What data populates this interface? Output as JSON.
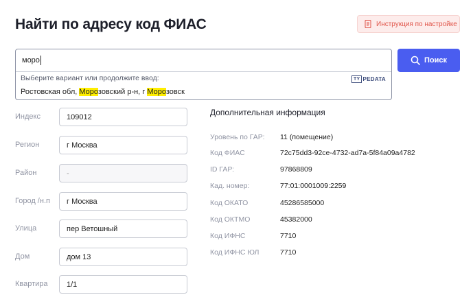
{
  "header": {
    "title": "Найти по адресу код ФИАС",
    "instruction_label": "Инструкция по настройке"
  },
  "search": {
    "value": "моро",
    "hint": "Выберите вариант или продолжите ввод:",
    "logo_box": "TY",
    "logo_rest": "PEDATA",
    "suggestion": {
      "part1": "Ростовская обл, ",
      "hl1": "Моро",
      "part2": "зовский р-н, г ",
      "hl2": "Моро",
      "part3": "зовск"
    },
    "button_label": "Поиск"
  },
  "fields": [
    {
      "label": "Индекс",
      "value": "109012"
    },
    {
      "label": "Регион",
      "value": "г Москва"
    },
    {
      "label": "Район",
      "value": "-"
    },
    {
      "label": "Город /н.п",
      "value": "г Москва"
    },
    {
      "label": "Улица",
      "value": "пер Ветошный"
    },
    {
      "label": "Дом",
      "value": "дом 13"
    },
    {
      "label": "Квартира",
      "value": "1/1"
    }
  ],
  "info": {
    "title": "Дополнительная информация",
    "rows": [
      {
        "label": "Уровень по ГАР:",
        "value": "11 (помещение)"
      },
      {
        "label": "Код ФИАС",
        "value": "72c75dd3-92ce-4732-ad7a-5f84a09a4782"
      },
      {
        "label": "ID ГАР:",
        "value": "97868809"
      },
      {
        "label": "Кад. номер:",
        "value": "77:01:0001009:2259"
      },
      {
        "label": "Код ОКАТО",
        "value": "45286585000"
      },
      {
        "label": "Код ОКТМО",
        "value": "45382000"
      },
      {
        "label": "Код ИФНС",
        "value": "7710"
      },
      {
        "label": "Код ИФНС ЮЛ",
        "value": "7710"
      }
    ]
  },
  "colors": {
    "accent": "#4a5df0",
    "instruction_text": "#e0554a",
    "highlight": "#ffee00"
  }
}
